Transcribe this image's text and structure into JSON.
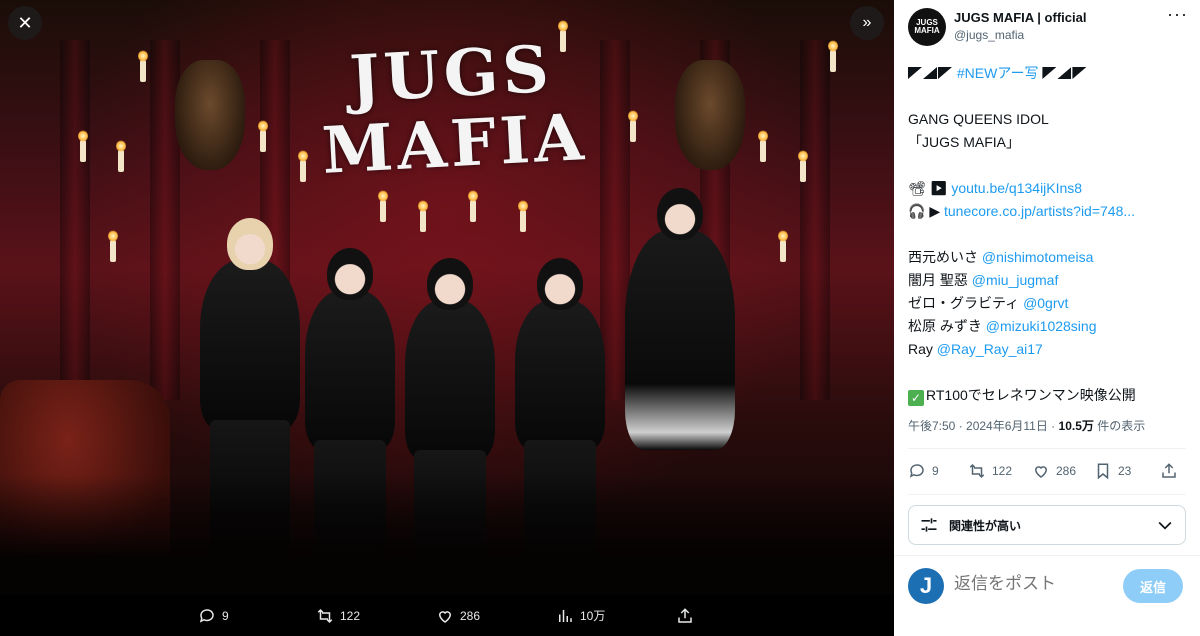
{
  "viewer": {
    "close_icon": "close-icon",
    "expand_icon": "chevron-double-right-icon",
    "image_text": "JUGS MAFIA",
    "actions": {
      "reply": "9",
      "retweet": "122",
      "like": "286",
      "views": "10万"
    }
  },
  "author": {
    "name": "JUGS MAFIA | official",
    "handle": "@jugs_mafia",
    "avatar_text": "JUGS MAFIA"
  },
  "tweet": {
    "line1_tag": "#NEWアー写",
    "line2": "GANG QUEENS IDOL",
    "line3": "「JUGS MAFIA」",
    "youtube_prefix": "📽 ▶ ",
    "youtube_link": "youtu.be/q134ijKIns8",
    "tunecore_prefix": "🎧 ▶ ",
    "tunecore_link": "tunecore.co.jp/artists?id=748...",
    "members": [
      {
        "name": "西元めいさ ",
        "handle": "@nishimotomeisa"
      },
      {
        "name": "闇月 聖惡 ",
        "handle": "@miu_jugmaf"
      },
      {
        "name": "ゼロ・グラビティ ",
        "handle": "@0grvt"
      },
      {
        "name": "松原 みずき ",
        "handle": "@mizuki1028sing"
      },
      {
        "name": "Ray ",
        "handle": "@Ray_Ray_ai17"
      }
    ],
    "announcement": "RT100でセレネワンマン映像公開"
  },
  "meta": {
    "time": "午後7:50 · 2024年6月11日 · ",
    "views_count": "10.5万",
    "views_label": " 件の表示"
  },
  "stats": {
    "reply": "9",
    "retweet": "122",
    "like": "286",
    "bookmark": "23"
  },
  "sort": {
    "label": "関連性が高い"
  },
  "reply": {
    "avatar_letter": "J",
    "placeholder": "返信をポスト",
    "button": "返信"
  }
}
